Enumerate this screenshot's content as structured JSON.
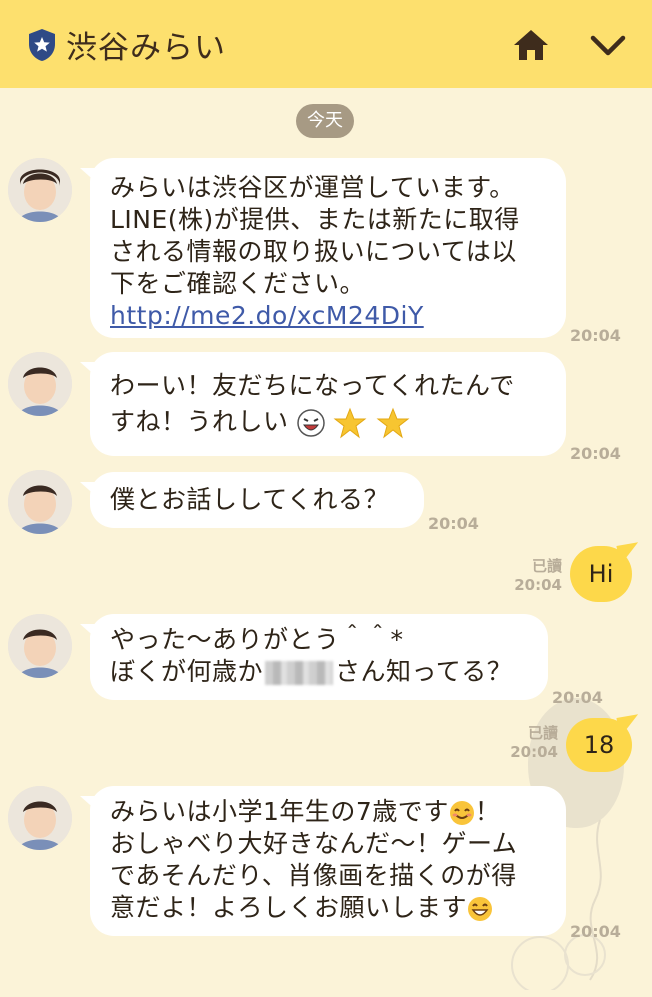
{
  "header": {
    "title": "渋谷みらい",
    "shield_icon": "shield-star-icon",
    "home_icon": "home-icon",
    "menu_icon": "chevron-down-icon",
    "bg_color": "#fde06e"
  },
  "date_separator": "今天",
  "messages": [
    {
      "from": "みらい",
      "lines": [
        "みらいは渋谷区が運営しています。",
        "LINE(株)が提供、または新たに取得",
        "される情報の取り扱いについては以",
        "下をご確認ください。"
      ],
      "link": "http://me2.do/xcM24DiY",
      "time": "20:04"
    },
    {
      "from": "みらい",
      "lines": [
        "わーい！友だちになってくれたんで",
        "すね！うれしい"
      ],
      "time": "20:04"
    },
    {
      "from": "みらい",
      "lines": [
        "僕とお話ししてくれる？"
      ],
      "time": "20:04"
    },
    {
      "from": "me",
      "text": "Hi",
      "read": "已讀",
      "time": "20:04"
    },
    {
      "from": "みらい",
      "lines": [
        "やった〜ありがとう＾＾*",
        "ぼくが何歳か",
        "さん知ってる？"
      ],
      "time": "20:04"
    },
    {
      "from": "me",
      "text": "18",
      "read": "已讀",
      "time": "20:04"
    },
    {
      "from": "みらい",
      "lines": [
        "みらいは小学1年生の7歳です",
        "！",
        "おしゃべり大好きなんだ〜！ゲーム",
        "であそんだり、肖像画を描くのが得",
        "意だよ！よろしくお願いします"
      ],
      "time": "20:04"
    }
  ]
}
